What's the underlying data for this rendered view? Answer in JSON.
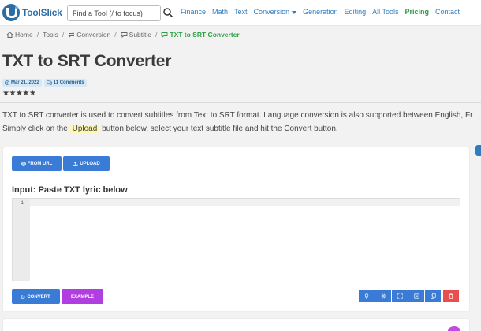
{
  "header": {
    "logo_text": "ToolSlick",
    "search_placeholder": "Find a Tool (/ to focus)",
    "nav": {
      "finance": "Finance",
      "math": "Math",
      "text": "Text",
      "conversion": "Conversion",
      "generation": "Generation",
      "editing": "Editing",
      "all_tools": "All Tools",
      "pricing": "Pricing",
      "contact": "Contact"
    }
  },
  "breadcrumb": {
    "home": "Home",
    "tools": "Tools",
    "conversion": "Conversion",
    "subtitle": "Subtitle",
    "current": "TXT to SRT Converter"
  },
  "page": {
    "title": "TXT to SRT Converter",
    "date": "Mar 21, 2022",
    "comments": "11 Comments",
    "stars": "★★★★★",
    "description_line1": "TXT to SRT converter is used to convert subtitles from Text to SRT format. Language conversion is also supported between English, Fr",
    "description_line2_prefix": "Simply click on the",
    "description_highlight": "Upload",
    "description_line2_suffix": "button below, select your text subtitle file and hit the Convert button."
  },
  "tool": {
    "from_url_label": "FROM URL",
    "upload_label": "UPLOAD",
    "input_label": "Input: Paste TXT lyric below",
    "line_number": "1",
    "convert_label": "CONVERT",
    "example_label": "EXAMPLE"
  },
  "colors": {
    "brand": "#2b6ea5",
    "link": "#2f7dc1",
    "pricing": "#2ea043",
    "primary_button": "#3a7bd5",
    "example_button": "#b03ee0",
    "delete_button": "#e84e4e"
  },
  "icons": {
    "toolbar": [
      "lightbulb-icon",
      "gear-icon",
      "fullscreen-icon",
      "save-icon",
      "copy-icon",
      "trash-icon"
    ]
  }
}
